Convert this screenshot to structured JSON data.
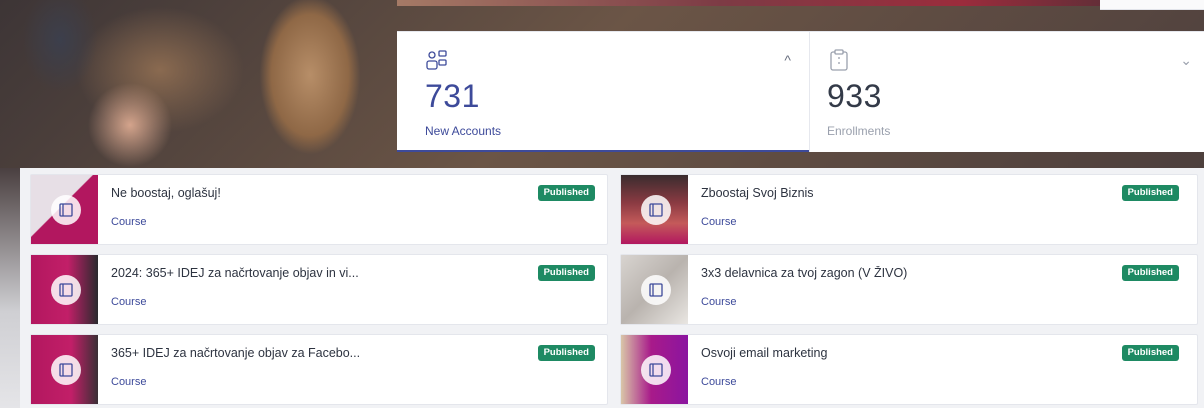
{
  "stats": {
    "new_accounts": {
      "value": "731",
      "label": "New Accounts",
      "icon": "user-accounts-icon",
      "chevron": "^"
    },
    "enrollments": {
      "value": "933",
      "label": "Enrollments",
      "icon": "clipboard-icon",
      "chevron": "⌄"
    }
  },
  "courses": [
    {
      "title": "Ne boostaj, oglašuj!",
      "type": "Course",
      "status": "Published"
    },
    {
      "title": "Zboostaj Svoj Biznis",
      "type": "Course",
      "status": "Published"
    },
    {
      "title": "2024: 365+ IDEJ za načrtovanje objav in vi...",
      "type": "Course",
      "status": "Published"
    },
    {
      "title": "3x3 delavnica za tvoj zagon (V ŽIVO)",
      "type": "Course",
      "status": "Published"
    },
    {
      "title": "365+ IDEJ za načrtovanje objav za Facebo...",
      "type": "Course",
      "status": "Published"
    },
    {
      "title": "Osvoji email marketing",
      "type": "Course",
      "status": "Published"
    }
  ],
  "colors": {
    "accent": "#3d4a9a",
    "published": "#1e8a63",
    "thumb_magenta": "#b2175f"
  }
}
